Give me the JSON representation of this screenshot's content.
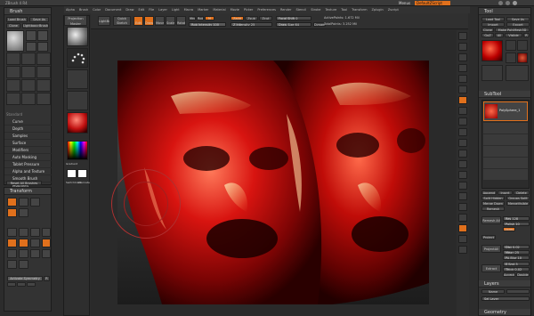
{
  "title": "ZBrush 4 R4",
  "titlebar_right": {
    "menus_label": "Menus",
    "script_label": "DefaultZScript"
  },
  "menubar": [
    "Alpha",
    "Brush",
    "Color",
    "Document",
    "Draw",
    "Edit",
    "File",
    "Layer",
    "Light",
    "Macro",
    "Marker",
    "Material",
    "Movie",
    "Picker",
    "Preferences",
    "Render",
    "Stencil",
    "Stroke",
    "Texture",
    "Tool",
    "Transform",
    "Zplugin",
    "Zscript"
  ],
  "toolbar": {
    "projection_master": "Projection Master",
    "lightbox": "LightBox",
    "quick_sketch": "Quick Sketch",
    "edit": "Edit",
    "draw": "Draw",
    "move": "Move",
    "scale": "Scale",
    "rotate": "Rotate",
    "mrgb": "Mrgb",
    "rgb": "Rgb",
    "m": "M",
    "zadd": "Zadd",
    "zsub": "Zsub",
    "zcut": "Zcut",
    "focal_shift": "Focal Shift 0",
    "draw_size": "Draw Size 64",
    "dynamic": "Dynamic",
    "active_points": "ActivePoints: 1.672 Mil",
    "total_points": "TotalPoints: 3.252 Mil",
    "rgb_intensity": "Rgb Intensity 100",
    "z_intensity": "Z Intensity 25"
  },
  "left_panel": {
    "brush_title": "Brush",
    "load_brush": "Load Brush",
    "save_as": "Save As",
    "clone": "Clone",
    "lightbox_brushes": "Lightbox>Brushes",
    "brush_name": "Standard",
    "menu_items": [
      "Curve",
      "Depth",
      "Samples",
      "Surface",
      "Modifiers",
      "Auto Masking",
      "Tablet Pressure",
      "Alpha and Texture",
      "Smooth Brush Modifiers"
    ],
    "reset_all": "Reset All Brushes",
    "transform_title": "Transform",
    "activate_symmetry": "Activate Symmetry",
    "r": "R"
  },
  "shelf": {
    "gradient_label": "Gradient",
    "switch_color": "SwitchColor",
    "alternate": "Alternate"
  },
  "right_panel": {
    "tool_title": "Tool",
    "load_tool": "Load Tool",
    "save_as": "Save As",
    "import": "Import",
    "export": "Export",
    "clone": "Clone",
    "make_polymesh": "Make PolyMesh3D",
    "goz": "GoZ",
    "all": "All",
    "visible": "Visible",
    "r": "R",
    "tool_name": "PolySphere_1",
    "subtool_title": "SubTool",
    "append": "Append",
    "insert": "Insert",
    "delete": "Delete",
    "split_hidden": "Split Hidden",
    "groups_split": "Groups Split",
    "merge_down": "Merge Down",
    "merge_visible": "MergeVisible",
    "remesh": "Remesh",
    "remesh_all": "Remesh All",
    "res": "Res 128",
    "polish": "Polish 10",
    "upres": "Upres",
    "project": "Project",
    "projectall": "ProjectAll",
    "dist": "Dist 0.02",
    "mean": "Mean 25",
    "pa_blur": "PA Blur 10",
    "extract": "Extract",
    "e_smt": "E Smt 5",
    "thick": "Thick 0.02",
    "accept": "Accept",
    "double": "Double",
    "layers_title": "Layers",
    "name_label": "Name",
    "sel_layer": "Sel Layer",
    "geometry_label": "Geometry"
  },
  "colors": {
    "accent": "#e0701c",
    "panel": "#333333",
    "canvas_top": "#4a4a4a",
    "canvas_bottom": "#1a1a1a"
  }
}
